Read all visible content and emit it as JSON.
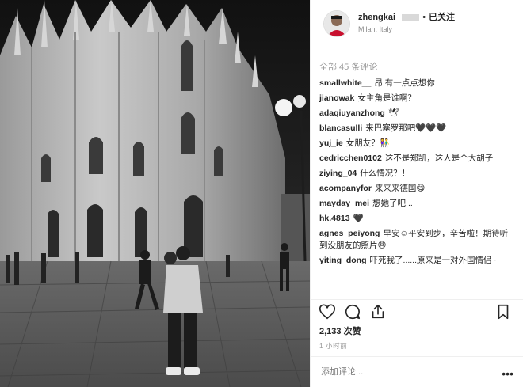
{
  "post": {
    "username": "zhengkai_",
    "follow_label": "已关注",
    "separator": "•",
    "location": "Milan, Italy"
  },
  "comments_header": "全部 45 条评论",
  "comments": [
    {
      "user": "smallwhite__",
      "text": "昂 有一点点想你"
    },
    {
      "user": "jianowak",
      "text": "女主角是谁啊？"
    },
    {
      "user": "adaqiuyanzhong",
      "text": "🕊"
    },
    {
      "user": "blancasulli",
      "text": "来巴塞罗那吧🖤🖤🖤"
    },
    {
      "user": "yuj_ie",
      "text": "女朋友？👫"
    },
    {
      "user": "cedricchen0102",
      "text": "这不是郑凯，这人是个大胡子"
    },
    {
      "user": "ziying_04",
      "text": "什么情况？！"
    },
    {
      "user": "acompanyfor",
      "text": "来来来德国😋"
    },
    {
      "user": "mayday_mei",
      "text": "想她了吧..."
    },
    {
      "user": "hk.4813",
      "text": "🖤"
    },
    {
      "user": "agnes_peiyong",
      "text": "早安☺平安到步，辛苦啦！期待听到没朋友的照片😠"
    },
    {
      "user": "yiting_dong",
      "text": "吓死我了......原来是一对外国情侣~"
    }
  ],
  "likes": "2,133 次赞",
  "time": "1 小时前",
  "add_comment_placeholder": "添加评论...",
  "more_label": "•••",
  "icons": {
    "like": "heart-icon",
    "comment": "comment-icon",
    "share": "share-icon",
    "save": "bookmark-icon"
  }
}
